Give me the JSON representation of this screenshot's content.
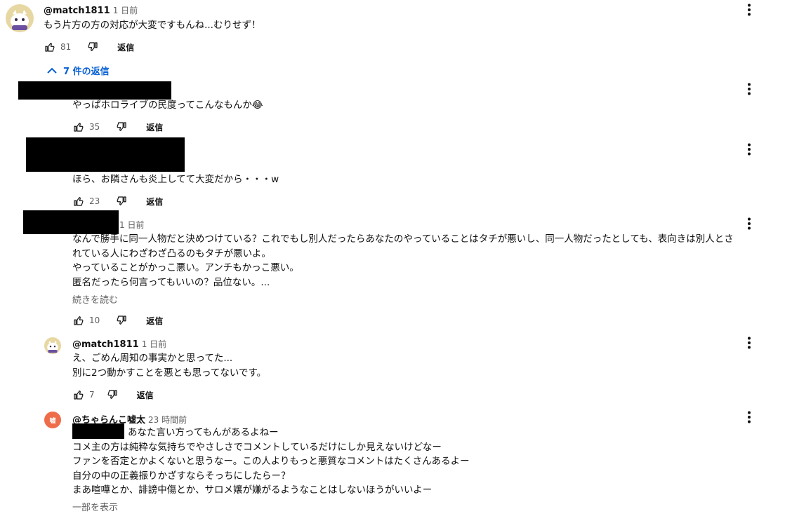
{
  "comment": {
    "author": "@match1811",
    "time": "1 日前",
    "text": "もう片方の方の対応が大変ですもんね...むりせず！",
    "likes": "81",
    "reply_label": "返信"
  },
  "replies_toggle": {
    "label": "7 件の返信"
  },
  "replies": [
    {
      "text_lines": [
        "やっぱホロライブの民度ってこんなもんか😂"
      ],
      "likes": "35",
      "reply_label": "返信"
    },
    {
      "text_lines": [
        "ほら、お隣さんも炎上してて大変だから・・・w"
      ],
      "likes": "23",
      "reply_label": "返信"
    },
    {
      "time": "1 日前",
      "text_lines": [
        "なんで勝手に同一人物だと決めつけている？これでもし別人だったらあなたのやっていることはタチが悪いし、同一人物だったとしても、表向きは別人とさ",
        "れている人にわざわざ凸るのもタチが悪いよ。",
        "やっていることがかっこ悪い。アンチもかっこ悪い。",
        "匿名だったら何言ってもいいの？品位ない。..."
      ],
      "read_more": "続きを読む",
      "likes": "10",
      "reply_label": "返信"
    },
    {
      "author": "@match1811",
      "time": "1 日前",
      "text_lines": [
        "え、ごめん周知の事実かと思ってた...",
        "別に2つ動かすことを悪とも思ってないです。"
      ],
      "likes": "7",
      "reply_label": "返信"
    },
    {
      "author": "@ちゃらんこ嘘太",
      "time": "23 時間前",
      "avatar_letter": "嘘",
      "text_first": "あなた言い方ってもんがあるよねー",
      "text_lines": [
        "コメ主の方は純粋な気持ちでやさしさでコメントしているだけにしか見えないけどなー",
        "ファンを否定とかよくないと思うなー。この人よりもっと悪質なコメントはたくさんあるよー",
        "自分の中の正義振りかざすならそっちにしたらー？",
        "まあ喧嘩とか、誹謗中傷とか、サロメ嬢が嫌がるようなことはしないほうがいいよー"
      ],
      "show_part": "一部を表示"
    }
  ],
  "colors": {
    "link_blue": "#065fd4",
    "meta_gray": "#606060",
    "avatar_orange": "#ef6c4a"
  },
  "icons": [
    "like-icon",
    "dislike-icon",
    "kebab-icon",
    "chevron-up-icon"
  ]
}
